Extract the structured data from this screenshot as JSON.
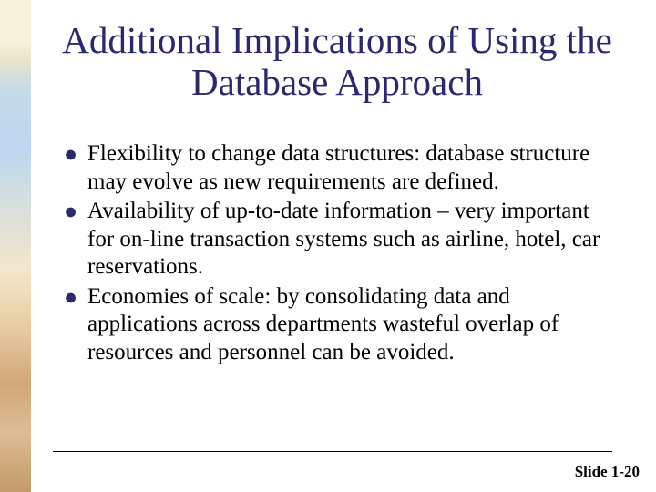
{
  "slide": {
    "title": "Additional Implications of Using the Database Approach",
    "bullets": [
      "Flexibility to change data structures: database structure may evolve as new requirements are defined.",
      "Availability of up-to-date information – very important for on-line transaction systems such as airline, hotel, car reservations.",
      "Economies of scale: by consolidating data and applications across departments wasteful overlap of resources and personnel can be avoided."
    ],
    "footer": {
      "slide_label": "Slide 1-20"
    }
  }
}
